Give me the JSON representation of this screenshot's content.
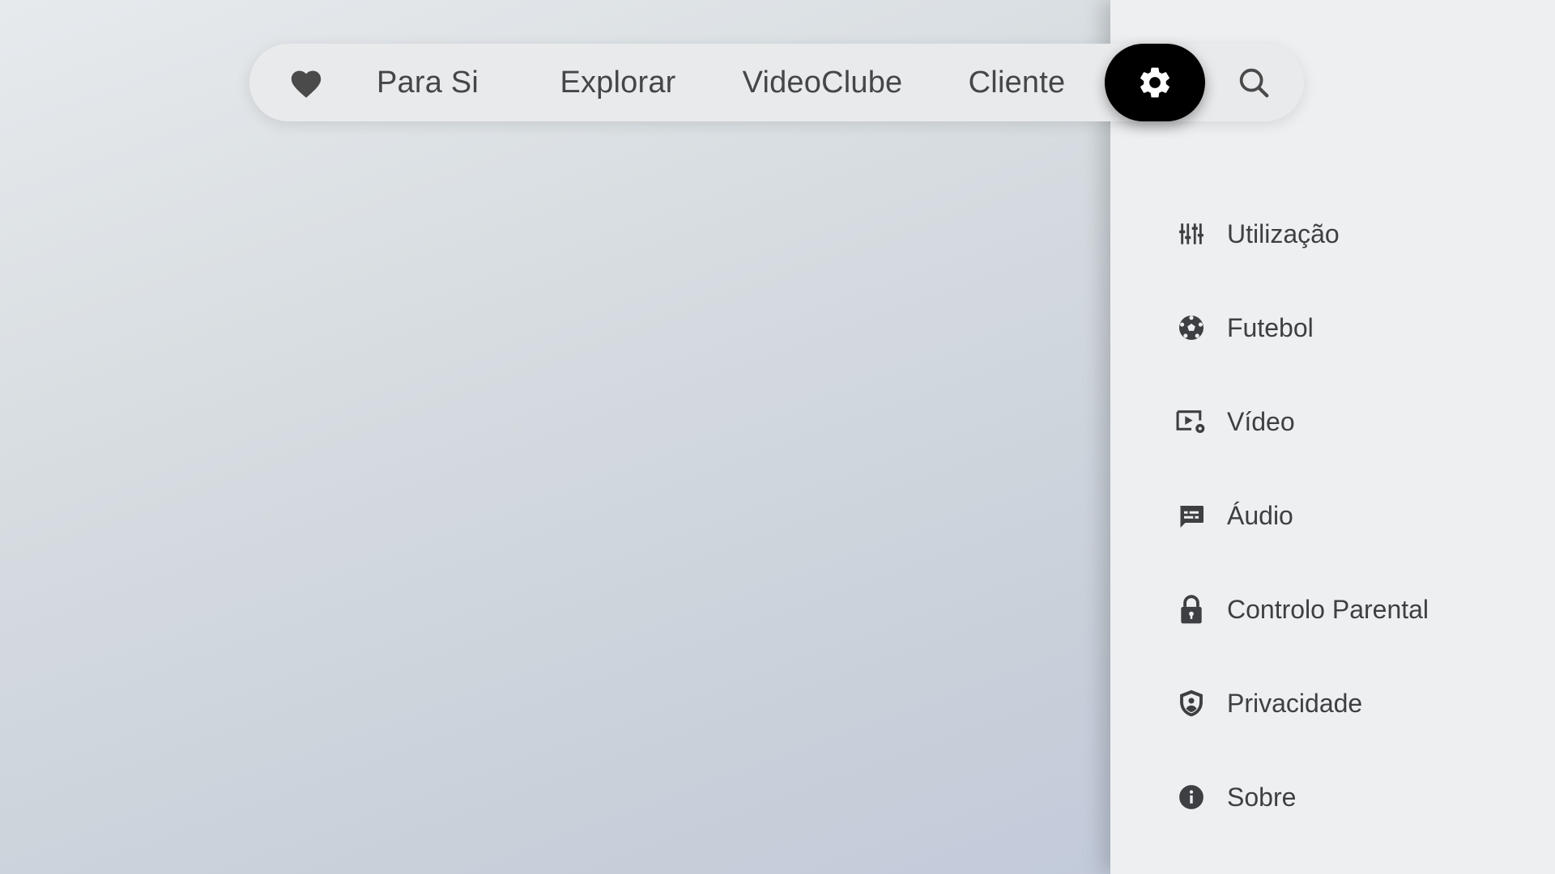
{
  "nav": {
    "favorites_icon": "heart-icon",
    "items": [
      {
        "label": "Para Si"
      },
      {
        "label": "Explorar"
      },
      {
        "label": "VideoClube"
      },
      {
        "label": "Cliente"
      }
    ],
    "settings_icon": "gear-icon",
    "search_icon": "search-icon",
    "active": "settings",
    "active_color": "#000000"
  },
  "settings_menu": {
    "items": [
      {
        "label": "Utilização",
        "icon": "sliders-icon"
      },
      {
        "label": "Futebol",
        "icon": "football-icon"
      },
      {
        "label": "Vídeo",
        "icon": "video-settings-icon"
      },
      {
        "label": "Áudio",
        "icon": "subtitles-icon"
      },
      {
        "label": "Controlo Parental",
        "icon": "lock-icon"
      },
      {
        "label": "Privacidade",
        "icon": "shield-icon"
      },
      {
        "label": "Sobre",
        "icon": "info-icon"
      }
    ]
  },
  "colors": {
    "text": "#444648",
    "panel_background": "#eeeff1",
    "icon": "#3d3f42"
  }
}
